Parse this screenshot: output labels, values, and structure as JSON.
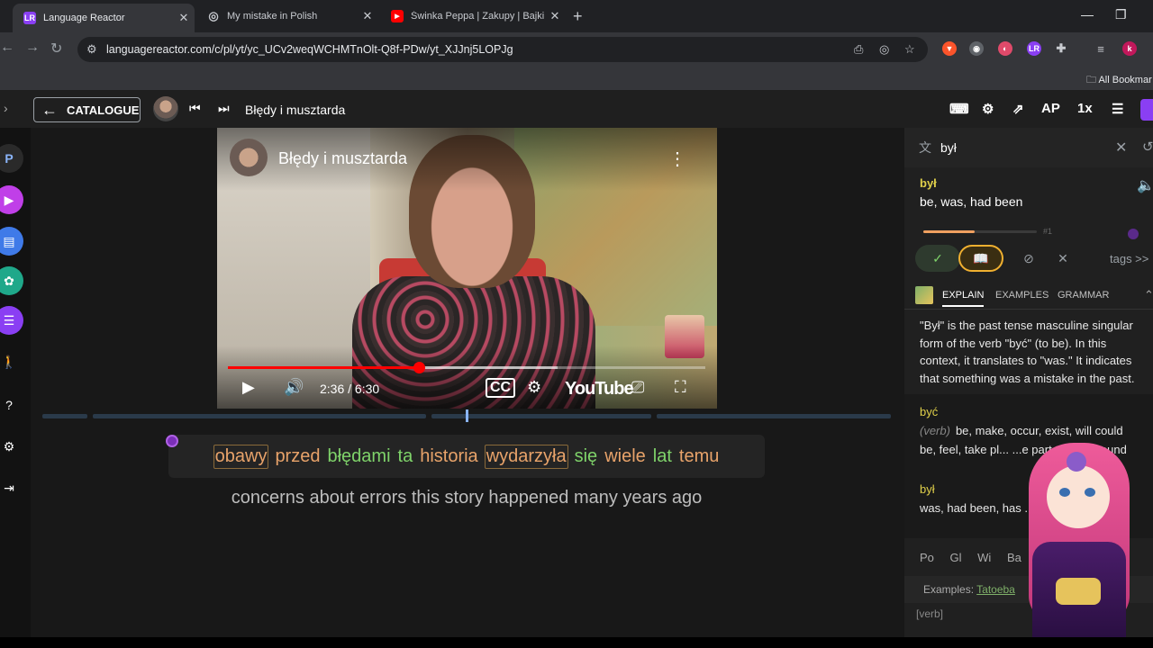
{
  "browser": {
    "tabs": [
      {
        "title": "Language Reactor",
        "icon": "LR",
        "icon_color": "#8a3ff3",
        "active": true
      },
      {
        "title": "My mistake in Polish",
        "icon": "◎",
        "icon_color": "#5f6368",
        "active": false
      },
      {
        "title": "Świnka Peppa | Zakupy | Bajki P",
        "icon": "▶",
        "icon_color": "#ff0000",
        "active": false
      }
    ],
    "url": "languagereactor.com/c/pl/yt/yc_UCv2weqWCHMTnOlt-Q8f-PDw/yt_XJJnj5LOPJg",
    "bookmarks_label": "All Bookmar"
  },
  "app": {
    "catalogue_label": "CATALOGUE",
    "video_title": "Błędy i musztarda",
    "toolbar": {
      "ap_label": "AP",
      "speed_label": "1x"
    }
  },
  "video": {
    "overlay_title": "Błędy i musztarda",
    "current_time": "2:36",
    "duration": "6:30",
    "time_display": "2:36 / 6:30",
    "progress_fraction": 0.4,
    "buffered_fraction": 0.69,
    "youtube_logo": "YouTube"
  },
  "subtitles": {
    "words": [
      {
        "text": "obawy",
        "color": "#e8a36a",
        "boxed": true
      },
      {
        "text": "przed",
        "color": "#e8a36a",
        "boxed": false
      },
      {
        "text": "błędami",
        "color": "#7fd36a",
        "boxed": false
      },
      {
        "text": "ta",
        "color": "#7fd36a",
        "boxed": false
      },
      {
        "text": "historia",
        "color": "#e8a36a",
        "boxed": false
      },
      {
        "text": "wydarzyła",
        "color": "#e8a36a",
        "boxed": true
      },
      {
        "text": "się",
        "color": "#7fd36a",
        "boxed": false
      },
      {
        "text": "wiele",
        "color": "#e8a36a",
        "boxed": false
      },
      {
        "text": "lat",
        "color": "#7fd36a",
        "boxed": false
      },
      {
        "text": "temu",
        "color": "#e8a36a",
        "boxed": false
      }
    ],
    "translation": "concerns about errors this story happened many years ago"
  },
  "dictionary": {
    "query": "był",
    "lemma": "był",
    "glosses": "be, was, had been",
    "rank": "#1",
    "frequency_fraction": 0.45,
    "tags_label": "tags >>",
    "tabs": [
      "EXPLAIN",
      "EXAMPLES",
      "GRAMMAR"
    ],
    "explain_text": "\"Był\" is the past tense masculine singular form of the verb \"być\" (to be). In this context, it translates to \"was.\" It indicates that something was a mistake in the past.",
    "entries": [
      {
        "lemma": "być",
        "pos": "(verb)",
        "text": "be, make, occur, exist, will could be, feel, take pl... ...e part, come around"
      },
      {
        "lemma": "był",
        "pos": "",
        "text": "was, had been, has ... ...been, had"
      }
    ],
    "lookup_sources": [
      "Po",
      "Gl",
      "Wi",
      "Ba"
    ],
    "examples_prefix": "Examples:",
    "examples_link": "Tatoeba",
    "verb_tag": "[verb]"
  },
  "colors": {
    "accent_purple": "#8a3ff3",
    "known_green": "#7fd36a",
    "learning_orange": "#e8a36a",
    "lemma_yellow": "#e0d04a"
  }
}
